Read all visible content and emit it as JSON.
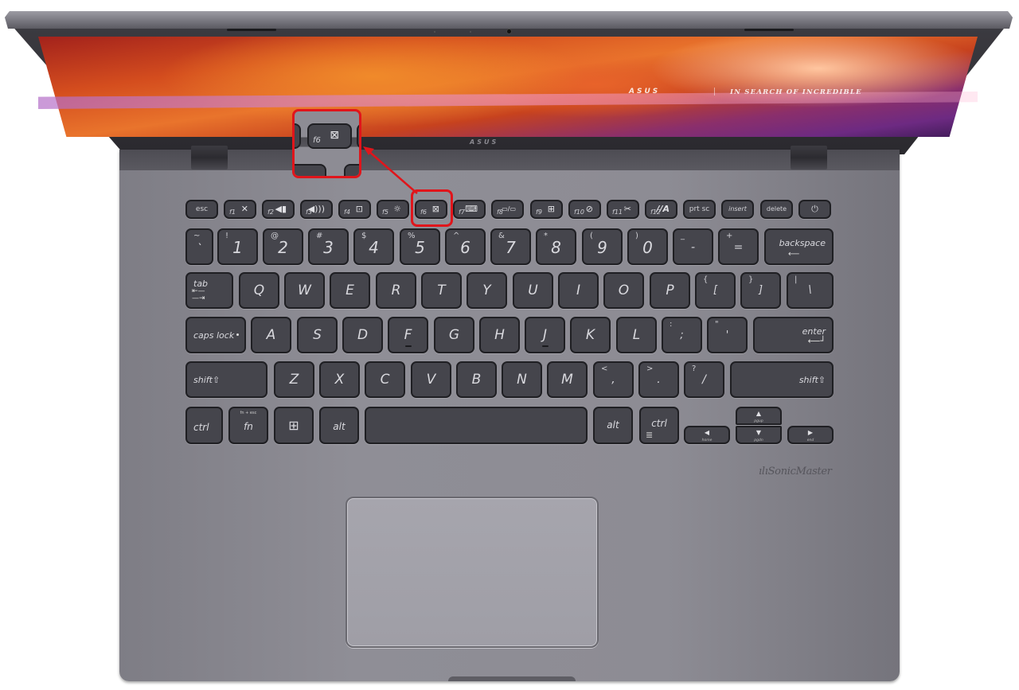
{
  "screen": {
    "logo": "ASUS",
    "tagline": "IN SEARCH OF INCREDIBLE",
    "bezel_logo": "ASUS"
  },
  "annotation": {
    "highlighted_key": "f6",
    "highlight_color": "#e0151b",
    "callout_label": "f6",
    "callout_icon": "touchpad-toggle-icon",
    "callout_icon_glyph": "⊠"
  },
  "keyboard": {
    "function_row": [
      {
        "id": "esc",
        "label": "esc"
      },
      {
        "id": "f1",
        "flabel": "f1",
        "icon": "mute-icon",
        "glyph": "🔇"
      },
      {
        "id": "f2",
        "flabel": "f2",
        "icon": "volume-down-icon",
        "glyph": "🔈"
      },
      {
        "id": "f3",
        "flabel": "f3",
        "icon": "volume-up-icon",
        "glyph": "🔊"
      },
      {
        "id": "f4",
        "flabel": "f4",
        "icon": "brightness-down-icon",
        "glyph": "⊡"
      },
      {
        "id": "f5",
        "flabel": "f5",
        "icon": "brightness-up-icon",
        "glyph": "☼"
      },
      {
        "id": "f6",
        "flabel": "f6",
        "icon": "touchpad-toggle-icon",
        "glyph": "⊠"
      },
      {
        "id": "f7",
        "flabel": "f7",
        "icon": "keyboard-backlight-icon",
        "glyph": "⌨"
      },
      {
        "id": "f8",
        "flabel": "f8",
        "icon": "display-switch-icon",
        "glyph": "▭/▭"
      },
      {
        "id": "f9",
        "flabel": "f9",
        "icon": "lock-windows-icon",
        "glyph": "⊞"
      },
      {
        "id": "f10",
        "flabel": "f10",
        "icon": "camera-off-icon",
        "glyph": "⊘"
      },
      {
        "id": "f11",
        "flabel": "f11",
        "icon": "screen-snip-icon",
        "glyph": "✂"
      },
      {
        "id": "f12",
        "flabel": "f12",
        "icon": "myasus-icon",
        "glyph": "//A"
      },
      {
        "id": "prtsc",
        "label": "prt sc"
      },
      {
        "id": "insert",
        "label": "insert"
      },
      {
        "id": "delete",
        "label": "delete"
      },
      {
        "id": "power",
        "icon": "power-icon",
        "glyph": "⏻"
      }
    ],
    "number_row": [
      {
        "main": "`",
        "shift": "~"
      },
      {
        "main": "1",
        "shift": "!"
      },
      {
        "main": "2",
        "shift": "@"
      },
      {
        "main": "3",
        "shift": "#"
      },
      {
        "main": "4",
        "shift": "$"
      },
      {
        "main": "5",
        "shift": "%"
      },
      {
        "main": "6",
        "shift": "^"
      },
      {
        "main": "7",
        "shift": "&"
      },
      {
        "main": "8",
        "shift": "*"
      },
      {
        "main": "9",
        "shift": "("
      },
      {
        "main": "0",
        "shift": ")"
      },
      {
        "main": "-",
        "shift": "_"
      },
      {
        "main": "=",
        "shift": "+"
      },
      {
        "main": "backspace",
        "shift": ""
      }
    ],
    "qwerty_row": [
      "tab",
      "Q",
      "W",
      "E",
      "R",
      "T",
      "Y",
      "U",
      "I",
      "O",
      "P",
      "[",
      "]",
      "\\"
    ],
    "qwerty_shift": [
      "",
      "",
      "",
      "",
      "",
      "",
      "",
      "",
      "",
      "",
      "",
      "{",
      "}",
      "|"
    ],
    "home_row": [
      "caps lock",
      "A",
      "S",
      "D",
      "F",
      "G",
      "H",
      "J",
      "K",
      "L",
      ";",
      "'",
      "enter"
    ],
    "home_shift": [
      "",
      "",
      "",
      "",
      "",
      "",
      "",
      "",
      "",
      "",
      ":",
      "\"",
      ""
    ],
    "bottom_row": [
      "shift",
      "Z",
      "X",
      "C",
      "V",
      "B",
      "N",
      "M",
      ",",
      ".",
      "/",
      "shift"
    ],
    "bottom_shift": [
      "",
      "",
      "",
      "",
      "",
      "",
      "",
      "",
      "<",
      ">",
      "?",
      ""
    ],
    "space_row": {
      "ctrl_left": "ctrl",
      "fn": "fn",
      "fn_sub": "fn + esc",
      "win_glyph": "⊞",
      "alt_left": "alt",
      "alt_right": "alt",
      "ctrl_right": "ctrl",
      "menu_glyph": "≣",
      "arrows": {
        "up": "▲",
        "up_label": "pgup",
        "down": "▼",
        "down_label": "pgdn",
        "left": "◀",
        "left_label": "home",
        "right": "▶",
        "right_label": "end"
      }
    }
  },
  "palmrest": {
    "brand": "SonicMaster"
  }
}
